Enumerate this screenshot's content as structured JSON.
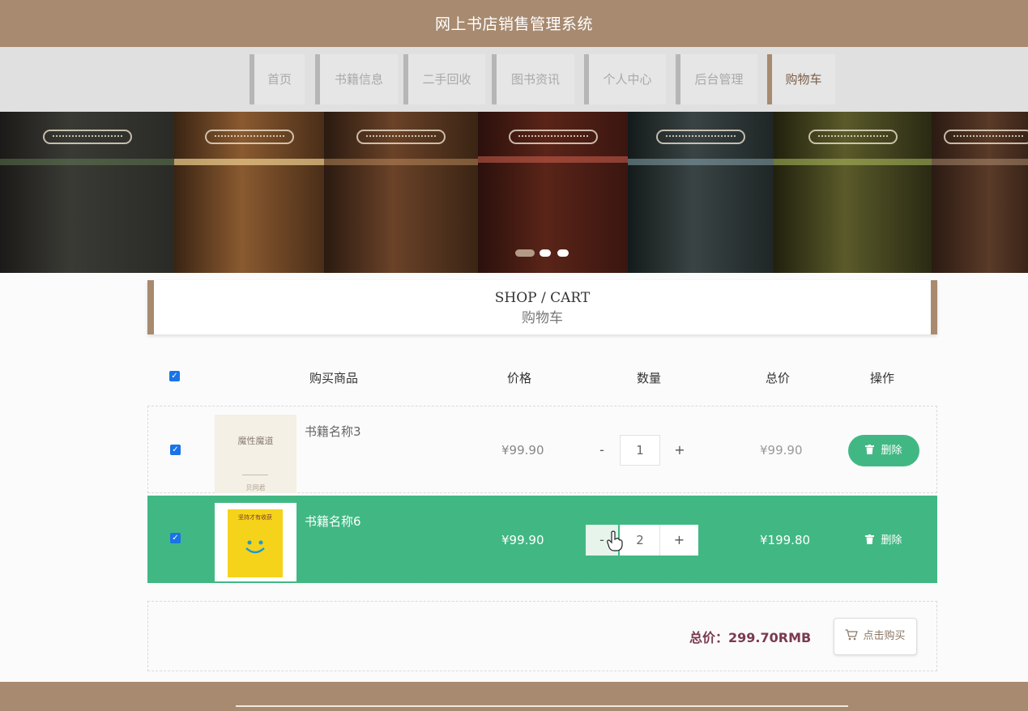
{
  "header": {
    "title": "网上书店销售管理系统",
    "bg_color": "#a78a6f"
  },
  "nav": {
    "items": [
      {
        "label": "首页"
      },
      {
        "label": "书籍信息"
      },
      {
        "label": "二手回收"
      },
      {
        "label": "图书资讯"
      },
      {
        "label": "个人中心"
      },
      {
        "label": "后台管理"
      },
      {
        "label": "购物车"
      }
    ],
    "active": "购物车"
  },
  "banner": {
    "slides": 3,
    "active_slide": 1
  },
  "section": {
    "title_en": "SHOP / CART",
    "title_cn": "购物车"
  },
  "table": {
    "headers": {
      "select_all": true,
      "product": "购买商品",
      "price": "价格",
      "quantity": "数量",
      "total": "总价",
      "action": "操作"
    },
    "rows": [
      {
        "checked": true,
        "name": "书籍名称3",
        "cover_title": "魔性魔道",
        "cover_author": "贝同君",
        "price": "¥99.90",
        "quantity": "1",
        "total": "¥99.90",
        "delete_label": "删除",
        "minus": "-",
        "plus": "+"
      },
      {
        "checked": true,
        "name": "书籍名称6",
        "cover_title": "坚持才有收获",
        "price": "¥99.90",
        "quantity": "2",
        "total": "¥199.80",
        "delete_label": "删除",
        "minus": "-",
        "plus": "+"
      }
    ]
  },
  "summary": {
    "total_label": "总价：299.70RMB",
    "buy_label": "点击购买"
  },
  "colors": {
    "accent": "#a78a6f",
    "green": "#41b883",
    "total_text": "#7a3a4f"
  },
  "icons": {
    "checkbox": "check-icon",
    "delete": "trash-icon",
    "buy": "cart-icon",
    "cursor": "hand-cursor-icon"
  }
}
